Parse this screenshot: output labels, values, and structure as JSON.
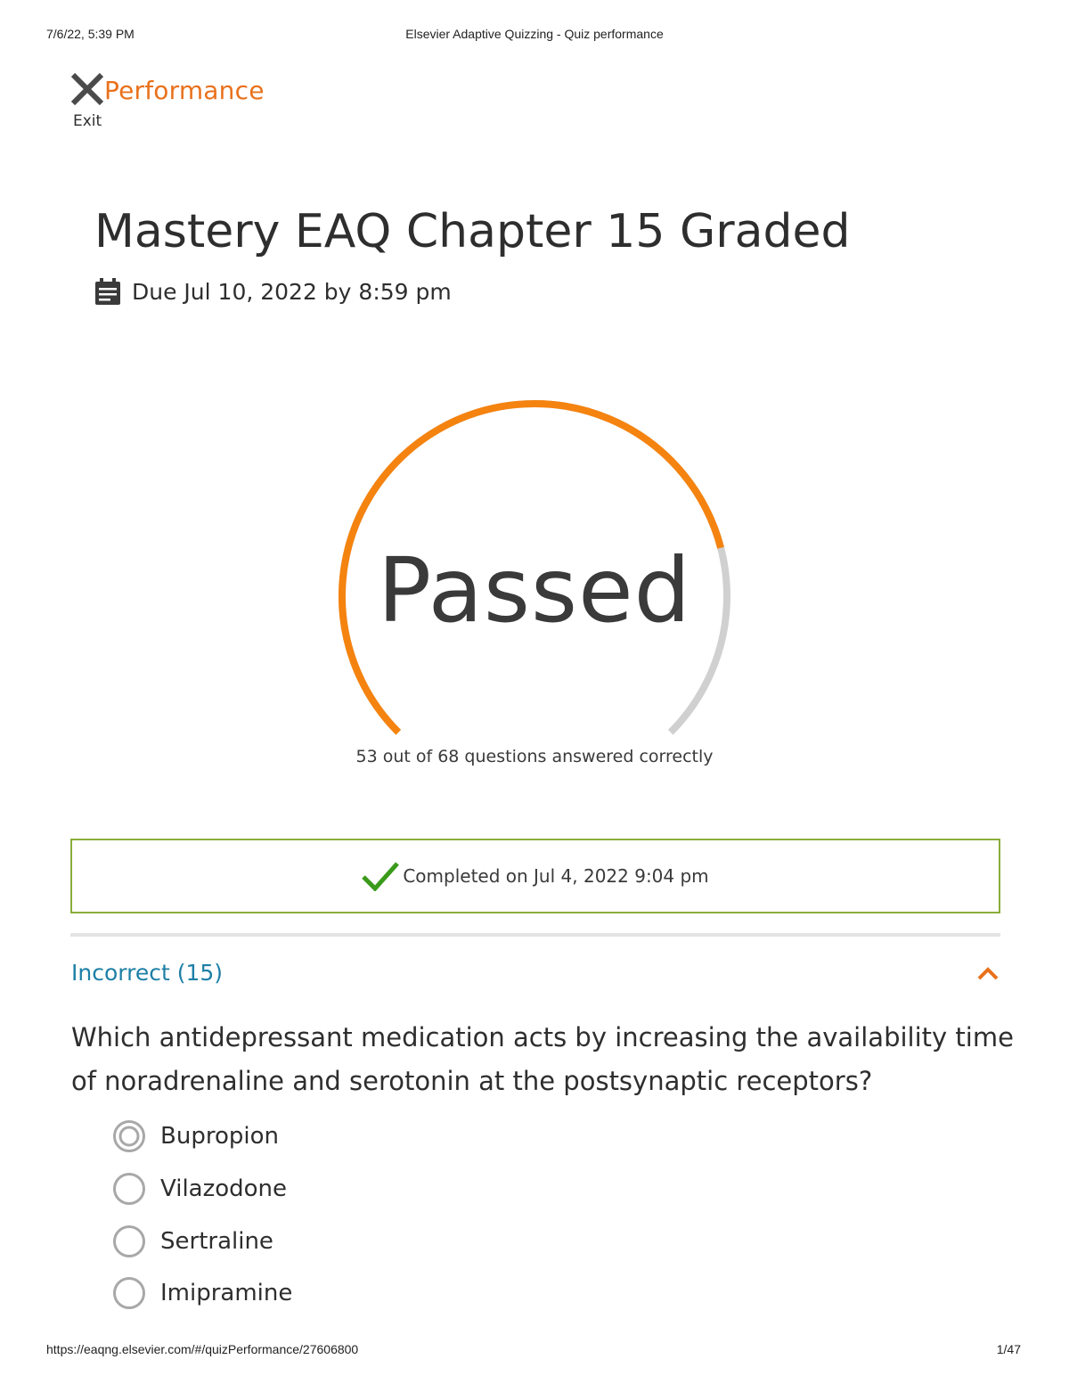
{
  "print_header": {
    "datetime": "7/6/22, 5:39 PM",
    "page_title": "Elsevier Adaptive Quizzing - Quiz performance"
  },
  "print_footer": {
    "url": "https://eaqng.elsevier.com/#/quizPerformance/27606800",
    "page": "1/47"
  },
  "exit": {
    "icon": "close-icon",
    "title": "Performance",
    "label": "Exit"
  },
  "quiz": {
    "title": "Mastery EAQ Chapter 15 Graded",
    "due_icon": "calendar-icon",
    "due_text": "Due Jul 10, 2022 by 8:59 pm"
  },
  "result": {
    "status": "Passed",
    "correct": 53,
    "total": 68,
    "score_text": "53 out of 68 questions answered correctly",
    "progress_fraction": 0.7794
  },
  "completion": {
    "icon": "checkmark-icon",
    "text": "Completed on Jul 4, 2022 9:04 pm"
  },
  "section": {
    "title": "Incorrect (15)",
    "toggle_icon": "chevron-up-icon",
    "expanded": true
  },
  "question": {
    "text": "Which antidepressant medication acts by increasing the availability time of noradrenaline and serotonin at the postsynaptic receptors?",
    "options": [
      {
        "label": "Bupropion",
        "selected": true
      },
      {
        "label": "Vilazodone",
        "selected": false
      },
      {
        "label": "Sertraline",
        "selected": false
      },
      {
        "label": "Imipramine",
        "selected": false
      }
    ]
  },
  "colors": {
    "accent_orange": "#f5830f",
    "track_gray": "#d0d0d0",
    "success_green": "#8cad3a",
    "check_green": "#3a9a1a",
    "link_blue": "#1e7fa6",
    "title_orange": "#e9711c"
  }
}
